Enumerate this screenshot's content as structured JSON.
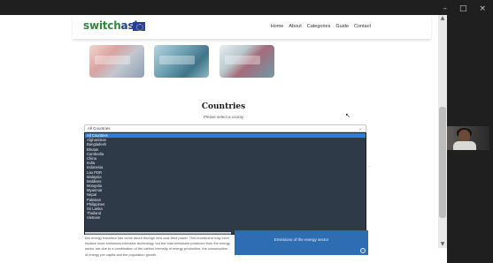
{
  "window": {
    "controls": {
      "minimize": "–",
      "maximize": "□",
      "close": "×"
    }
  },
  "site": {
    "logo_part1": "switch",
    "logo_part2": "asia",
    "nav": [
      "Home",
      "About",
      "Categories",
      "Guide",
      "Contact"
    ]
  },
  "countries": {
    "title": "Countries",
    "subtitle": "Please select a county",
    "select_value": "All Countries",
    "options": [
      "All Countries",
      "Afghanistan",
      "Bangladesh",
      "Bhutan",
      "Cambodia",
      "China",
      "India",
      "Indonesia",
      "Lao PDR",
      "Malaysia",
      "Maldives",
      "Mongolia",
      "Myanmar",
      "Nepal",
      "Pakistan",
      "Philippines",
      "Sri Lanka",
      "Thailand",
      "Vietnam"
    ],
    "selected_index": 0
  },
  "content": {
    "paragraph": "this energy transition has come about through new coal-fired power. This investment may even replace more emissions-intensive technology, but the total emissions produced from the energy sector are due to a combination of the carbon intensity of energy production, the consumption of energy per capita and the population growth.",
    "card_label": "Emissions of the energy sector"
  },
  "colors": {
    "dropdown_bg": "#2f3a48",
    "selected_option": "#2b7de0",
    "card_blue": "#2f6db3",
    "logo_green": "#2e8b3a",
    "logo_blue": "#1f3d8a"
  }
}
